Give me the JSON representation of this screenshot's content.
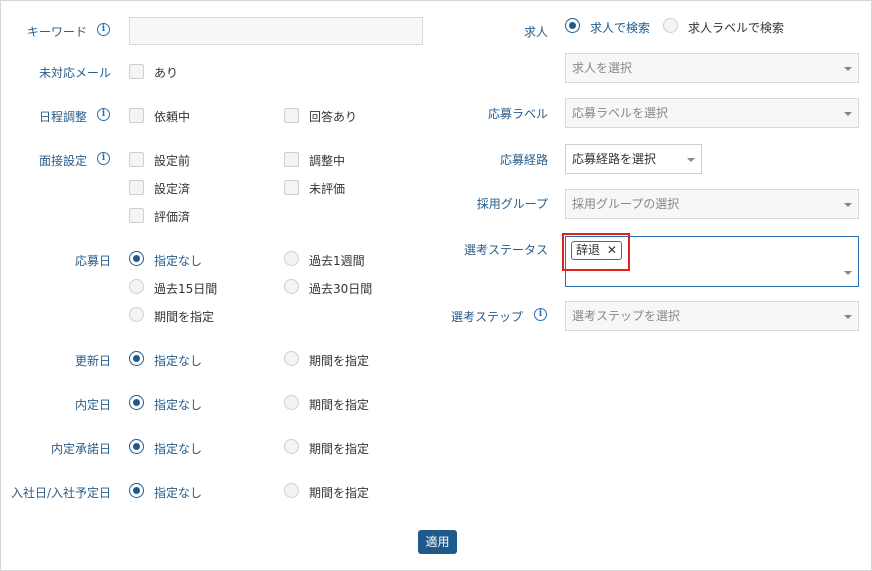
{
  "left": {
    "keyword": {
      "label": "キーワード",
      "value": ""
    },
    "unanswered_mail": {
      "label": "未対応メール",
      "option": "あり"
    },
    "schedule": {
      "label": "日程調整",
      "options": [
        "依頼中",
        "回答あり"
      ]
    },
    "interview": {
      "label": "面接設定",
      "options": [
        "設定前",
        "調整中",
        "設定済",
        "未評価",
        "評価済"
      ]
    },
    "apply_date": {
      "label": "応募日",
      "options": [
        "指定なし",
        "過去1週間",
        "過去15日間",
        "過去30日間",
        "期間を指定"
      ],
      "selected": "指定なし"
    },
    "updated_date": {
      "label": "更新日",
      "options": [
        "指定なし",
        "期間を指定"
      ],
      "selected": "指定なし"
    },
    "offer_date": {
      "label": "内定日",
      "options": [
        "指定なし",
        "期間を指定"
      ],
      "selected": "指定なし"
    },
    "offer_accept_date": {
      "label": "内定承諾日",
      "options": [
        "指定なし",
        "期間を指定"
      ],
      "selected": "指定なし"
    },
    "join_date": {
      "label": "入社日/入社予定日",
      "options": [
        "指定なし",
        "期間を指定"
      ],
      "selected": "指定なし"
    }
  },
  "right": {
    "job": {
      "label": "求人",
      "options": [
        "求人で検索",
        "求人ラベルで検索"
      ],
      "selected": "求人で検索",
      "placeholder": "求人を選択"
    },
    "apply_label": {
      "label": "応募ラベル",
      "placeholder": "応募ラベルを選択"
    },
    "apply_route": {
      "label": "応募経路",
      "value": "応募経路を選択"
    },
    "hiring_group": {
      "label": "採用グループ",
      "placeholder": "採用グループの選択"
    },
    "selection_status": {
      "label": "選考ステータス",
      "tags": [
        "辞退"
      ],
      "remove_glyph": "✕"
    },
    "selection_step": {
      "label": "選考ステップ",
      "placeholder": "選考ステップを選択"
    }
  },
  "apply_button": "適用",
  "info_glyph": "i"
}
